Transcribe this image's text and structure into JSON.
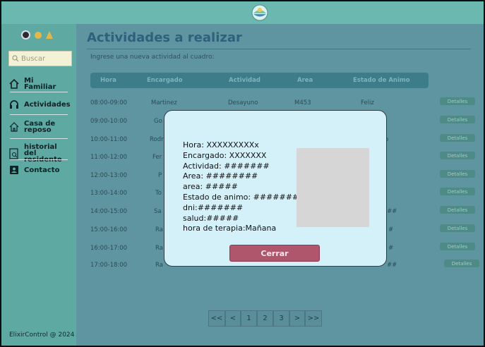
{
  "app": {
    "footer": "ElixirControl @ 2024"
  },
  "sidebar": {
    "search_placeholder": "Buscar",
    "items": [
      {
        "label": "Mi Familiar",
        "icon": "home-icon"
      },
      {
        "label": "Actividades",
        "icon": "headset-icon"
      },
      {
        "label": "Casa de reposo",
        "icon": "house-icon"
      },
      {
        "label": "historial del residente",
        "icon": "document-search-icon"
      },
      {
        "label": "Contacto",
        "icon": "contact-card-icon"
      }
    ]
  },
  "main": {
    "title": "Actividades a realizar",
    "subtitle": "Ingrese una nueva actividad al cuadro:",
    "columns": [
      "Hora",
      "Encargado",
      "Actividad",
      "Area",
      "Estado de Animo"
    ],
    "details_label": "Detalles",
    "rows": [
      {
        "hora": "08:00-09:00",
        "encargado": "Martinez",
        "actividad": "Desayuno",
        "area": "M453",
        "estado": "Feliz"
      },
      {
        "hora": "09:00-10:00",
        "encargado": "Go",
        "actividad": "",
        "area": "",
        "estado": ""
      },
      {
        "hora": "10:00-11:00",
        "encargado": "Rodr",
        "actividad": "",
        "area": "",
        "estado": "o"
      },
      {
        "hora": "11:00-12:00",
        "encargado": "Fer",
        "actividad": "",
        "area": "",
        "estado": ""
      },
      {
        "hora": "12:00-13:00",
        "encargado": "P",
        "actividad": "",
        "area": "",
        "estado": ""
      },
      {
        "hora": "13:00-14:00",
        "encargado": "To",
        "actividad": "",
        "area": "",
        "estado": ""
      },
      {
        "hora": "14:00-15:00",
        "encargado": "Sa",
        "actividad": "",
        "area": "",
        "estado": "##"
      },
      {
        "hora": "15:00-16:00",
        "encargado": "Ra",
        "actividad": "",
        "area": "",
        "estado": "#"
      },
      {
        "hora": "16:00-17:00",
        "encargado": "Ra",
        "actividad": "",
        "area": "",
        "estado": "#"
      },
      {
        "hora": "17:00-18:00",
        "encargado": "Ra",
        "actividad": "",
        "area": "",
        "estado": "##"
      }
    ],
    "pagination": [
      "<<",
      "<",
      "1",
      "2",
      "3",
      ">",
      ">>"
    ]
  },
  "modal": {
    "lines": [
      "Hora: XXXXXXXXXx",
      "Encargado: XXXXXXX",
      "Actividad: #######",
      "Area: ########",
      "area: #####",
      "Estado de animo: #######",
      "dni:#######",
      "salud:#####",
      "hora de terapia:Mañana"
    ],
    "close_label": "Cerrar"
  },
  "colors": {
    "topbar": "#6ab8b0",
    "sidebar": "#5eaaa2",
    "title": "#2f607c",
    "close_button": "#b0566c",
    "modal_bg": "#d4f1fa"
  }
}
